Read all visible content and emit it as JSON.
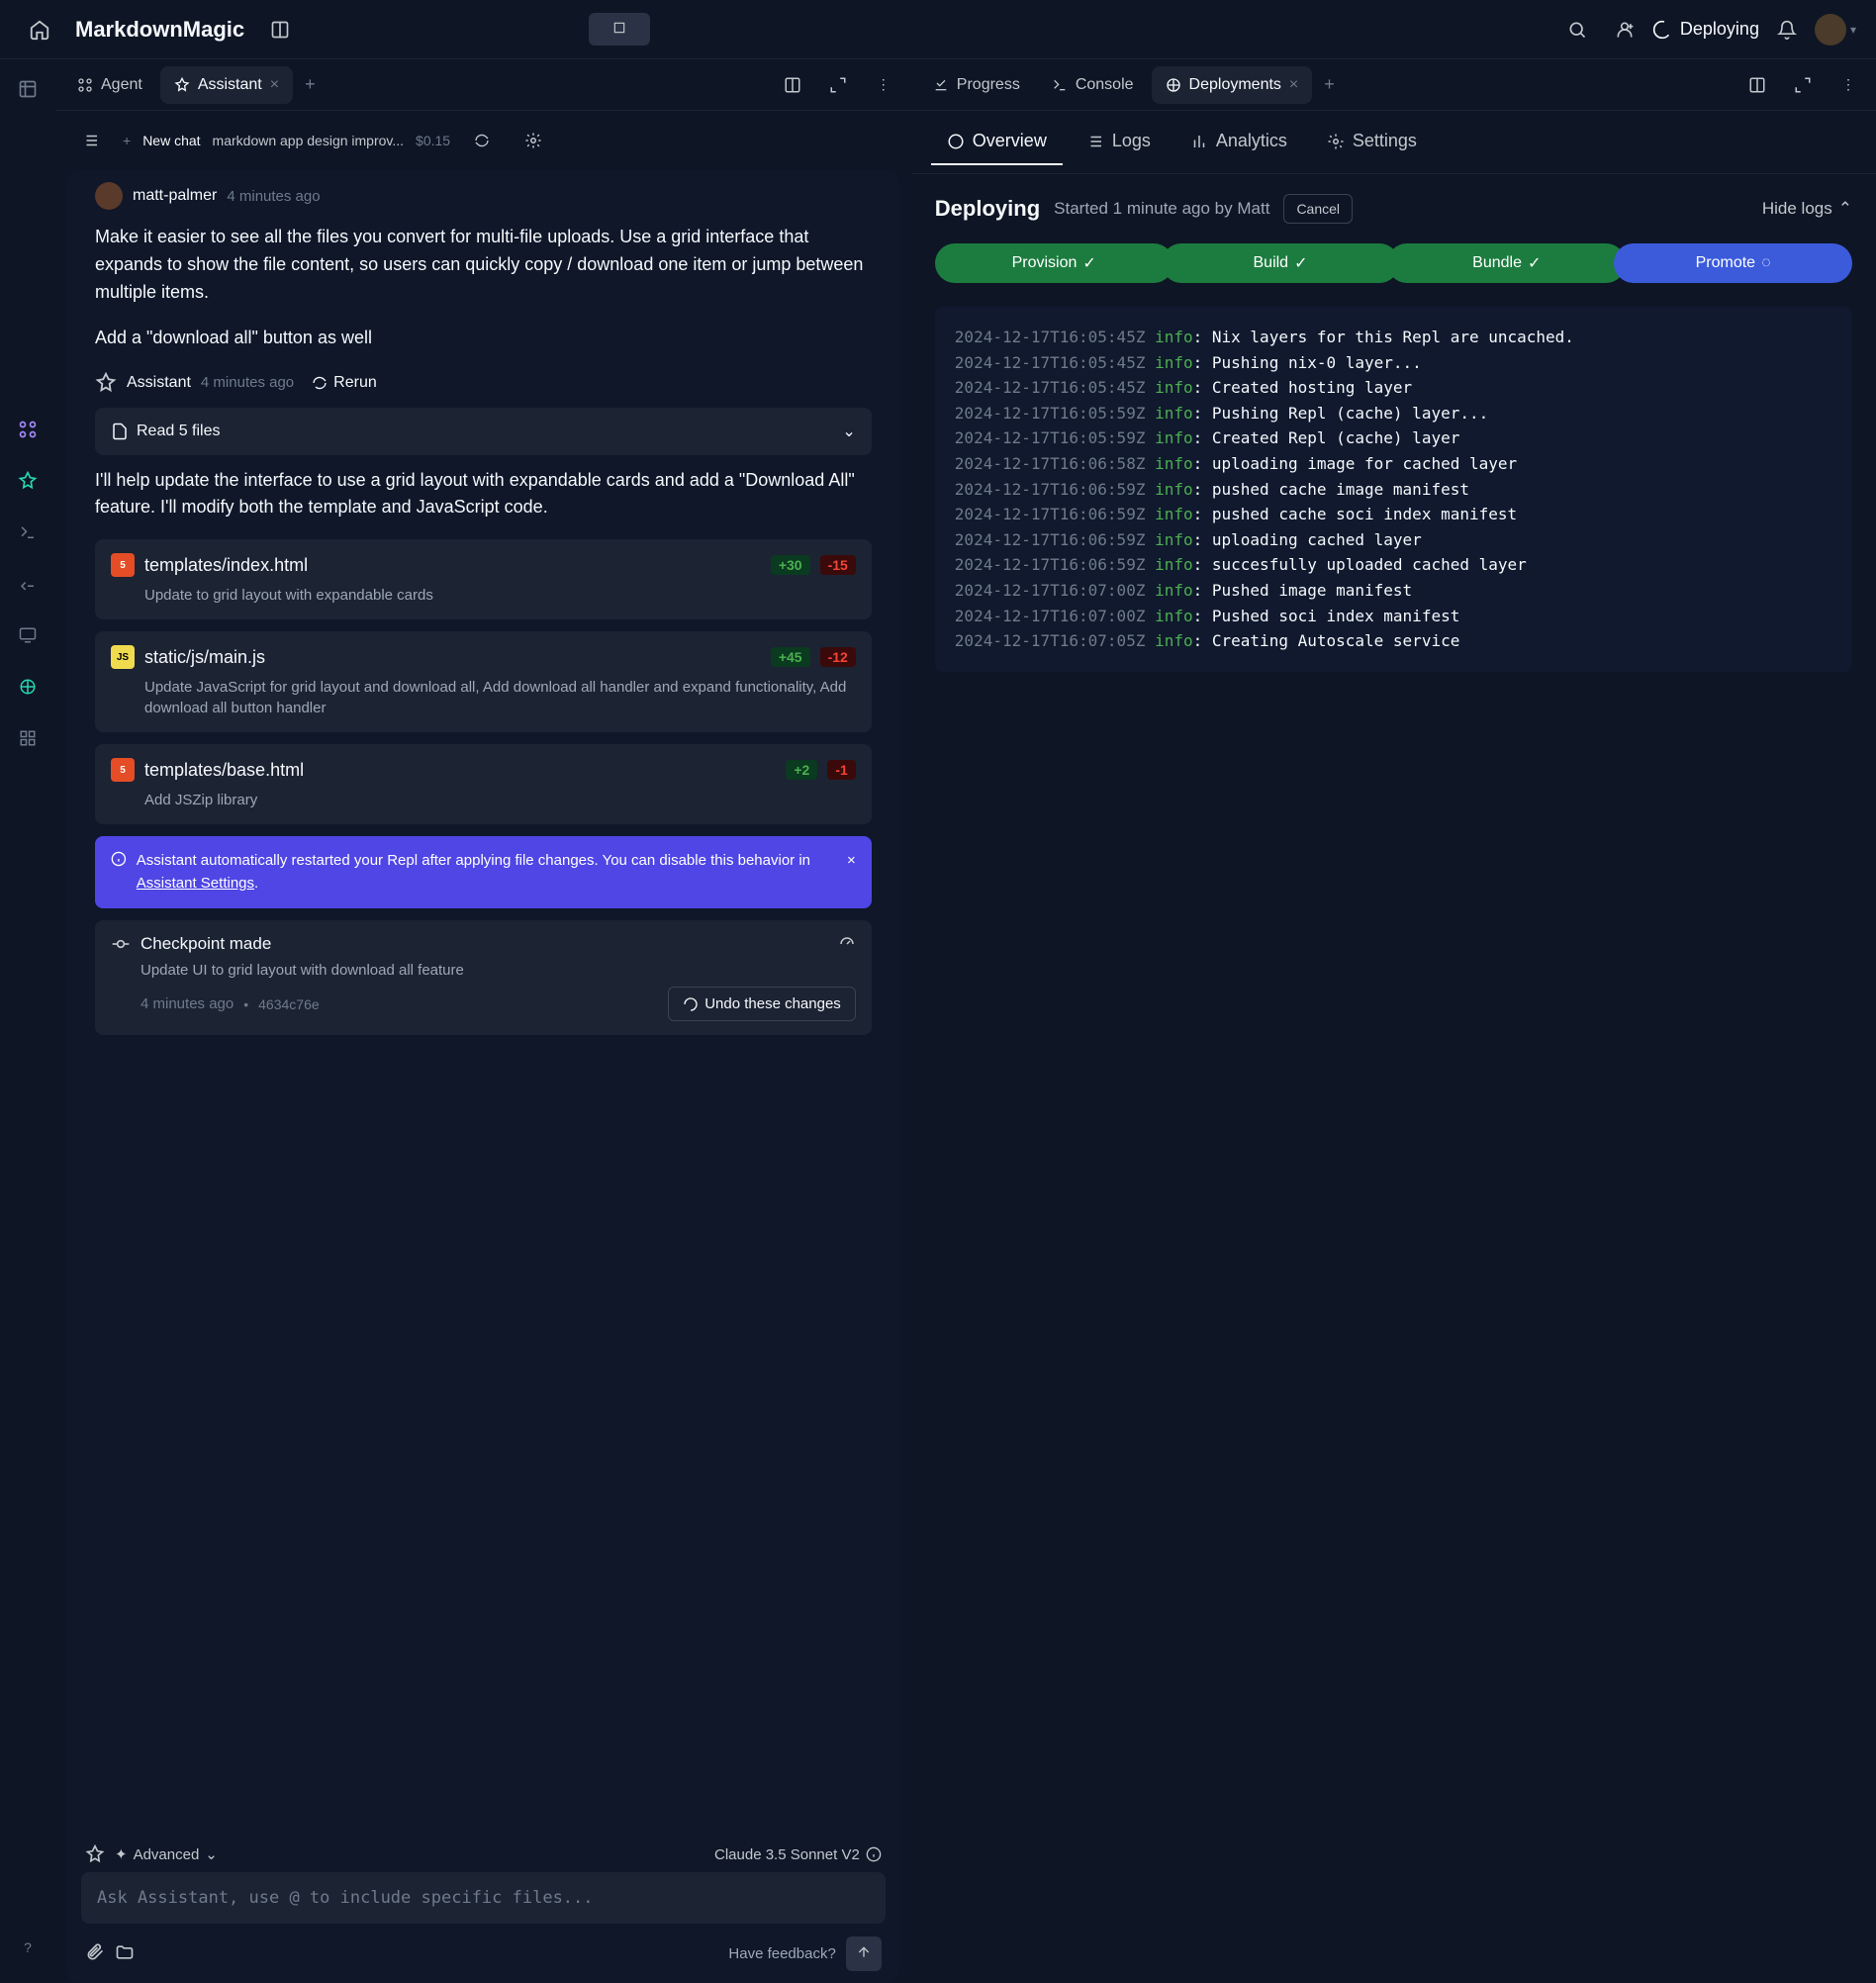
{
  "app_title": "MarkdownMagic",
  "titlebar": {
    "deploying_label": "Deploying"
  },
  "left_pane": {
    "tabs": [
      {
        "label": "Agent"
      },
      {
        "label": "Assistant"
      }
    ],
    "chat_header": {
      "new_chat": "New chat",
      "title": "markdown app design improv...",
      "cost": "$0.15"
    },
    "user_msg": {
      "name": "matt-palmer",
      "time": "4 minutes ago",
      "body1": "Make it easier to see all the files you convert for multi-file uploads. Use a grid interface that expands to show the file content, so users can quickly copy / download one item or jump between multiple items.",
      "body2": "Add a \"download all\" button as well"
    },
    "assistant_header": {
      "name": "Assistant",
      "time": "4 minutes ago",
      "rerun": "Rerun"
    },
    "read_files": "Read 5 files",
    "assistant_intro": "I'll help update the interface to use a grid layout with expandable cards and add a \"Download All\" feature. I'll modify both the template and JavaScript code.",
    "file_changes": [
      {
        "icon": "html",
        "name": "templates/index.html",
        "add": "+30",
        "del": "-15",
        "desc": "Update to grid layout with expandable cards"
      },
      {
        "icon": "js",
        "name": "static/js/main.js",
        "add": "+45",
        "del": "-12",
        "desc": "Update JavaScript for grid layout and download all, Add download all handler and expand functionality, Add download all button handler"
      },
      {
        "icon": "html",
        "name": "templates/base.html",
        "add": "+2",
        "del": "-1",
        "desc": "Add JSZip library"
      }
    ],
    "banner": {
      "text_pre": "Assistant automatically restarted your Repl after applying file changes. You can disable this behavior in ",
      "link": "Assistant Settings",
      "text_post": "."
    },
    "checkpoint": {
      "title": "Checkpoint made",
      "desc": "Update UI to grid layout with download all feature",
      "time": "4 minutes ago",
      "hash": "4634c76e",
      "undo": "Undo these changes"
    },
    "input": {
      "advanced": "Advanced",
      "model": "Claude 3.5 Sonnet V2",
      "placeholder": "Ask Assistant, use @ to include specific files...",
      "feedback": "Have feedback?"
    }
  },
  "right_pane": {
    "tabs": [
      {
        "label": "Progress"
      },
      {
        "label": "Console"
      },
      {
        "label": "Deployments"
      }
    ],
    "subtabs": [
      {
        "label": "Overview"
      },
      {
        "label": "Logs"
      },
      {
        "label": "Analytics"
      },
      {
        "label": "Settings"
      }
    ],
    "deploy": {
      "title": "Deploying",
      "subtitle": "Started 1 minute ago by Matt",
      "cancel": "Cancel",
      "hide_logs": "Hide logs"
    },
    "stages": [
      {
        "label": "Provision",
        "state": "done"
      },
      {
        "label": "Build",
        "state": "done"
      },
      {
        "label": "Bundle",
        "state": "done"
      },
      {
        "label": "Promote",
        "state": "running"
      }
    ],
    "logs": [
      {
        "ts": "2024-12-17T16:05:45Z",
        "level": "info",
        "msg": "Nix layers for this Repl are uncached."
      },
      {
        "ts": "2024-12-17T16:05:45Z",
        "level": "info",
        "msg": "Pushing nix-0 layer..."
      },
      {
        "ts": "2024-12-17T16:05:45Z",
        "level": "info",
        "msg": "Created hosting layer"
      },
      {
        "ts": "2024-12-17T16:05:59Z",
        "level": "info",
        "msg": "Pushing Repl (cache) layer..."
      },
      {
        "ts": "2024-12-17T16:05:59Z",
        "level": "info",
        "msg": "Created Repl (cache) layer"
      },
      {
        "ts": "2024-12-17T16:06:58Z",
        "level": "info",
        "msg": "uploading image for cached layer"
      },
      {
        "ts": "2024-12-17T16:06:59Z",
        "level": "info",
        "msg": "pushed cache image manifest"
      },
      {
        "ts": "2024-12-17T16:06:59Z",
        "level": "info",
        "msg": "pushed cache soci index manifest"
      },
      {
        "ts": "2024-12-17T16:06:59Z",
        "level": "info",
        "msg": "uploading cached layer"
      },
      {
        "ts": "2024-12-17T16:06:59Z",
        "level": "info",
        "msg": "succesfully uploaded cached layer"
      },
      {
        "ts": "2024-12-17T16:07:00Z",
        "level": "info",
        "msg": "Pushed image manifest"
      },
      {
        "ts": "2024-12-17T16:07:00Z",
        "level": "info",
        "msg": "Pushed soci index manifest"
      },
      {
        "ts": "2024-12-17T16:07:05Z",
        "level": "info",
        "msg": "Creating Autoscale service"
      }
    ]
  }
}
